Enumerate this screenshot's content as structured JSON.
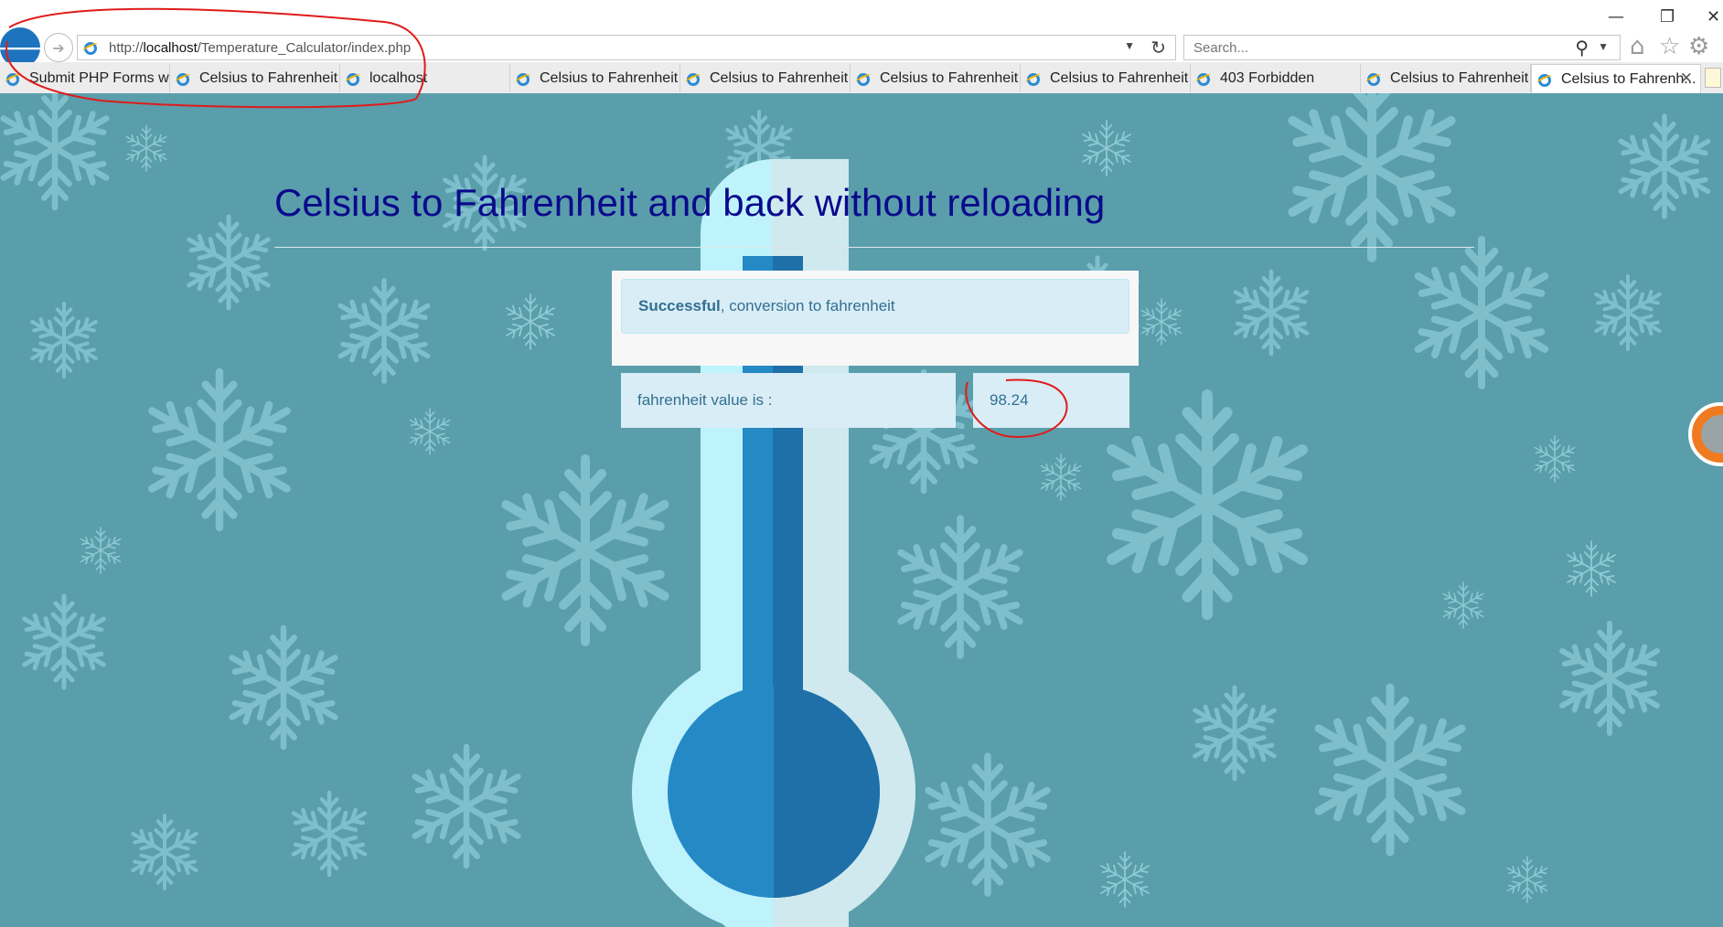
{
  "window": {
    "minimize_glyph": "—",
    "restore_glyph": "❐",
    "close_glyph": "✕"
  },
  "address": {
    "prefix": "http://",
    "host": "localhost",
    "path": "/Temperature_Calculator/index.php"
  },
  "search": {
    "placeholder": "Search..."
  },
  "tabs": [
    {
      "label": "Submit PHP Forms wi..."
    },
    {
      "label": "Celsius to Fahrenheit ..."
    },
    {
      "label": "localhost"
    },
    {
      "label": "Celsius to Fahrenheit ..."
    },
    {
      "label": "Celsius to Fahrenheit ..."
    },
    {
      "label": "Celsius to Fahrenheit ..."
    },
    {
      "label": "Celsius to Fahrenheit ..."
    },
    {
      "label": "403 Forbidden"
    },
    {
      "label": "Celsius to Fahrenheit ..."
    },
    {
      "label": "Celsius to Fahrenh...",
      "active": true
    }
  ],
  "icons": {
    "back": "back-arrow-icon",
    "forward": "forward-arrow-icon",
    "refresh": "refresh-icon",
    "search": "magnifier-icon",
    "home": "home-icon",
    "favorites": "star-icon",
    "tools": "gear-icon"
  },
  "page": {
    "title": "Celsius to Fahrenheit and back without reloading",
    "alert_strong": "Successful",
    "alert_text": ", conversion to fahrenheit",
    "result_label": "fahrenheit value is :",
    "result_value": "98.24"
  },
  "colors": {
    "background": "#5a9eab",
    "title": "#0a0a8c",
    "alert_bg": "#d9edf7",
    "alert_text": "#31708f",
    "annotation": "#e01b1b"
  }
}
